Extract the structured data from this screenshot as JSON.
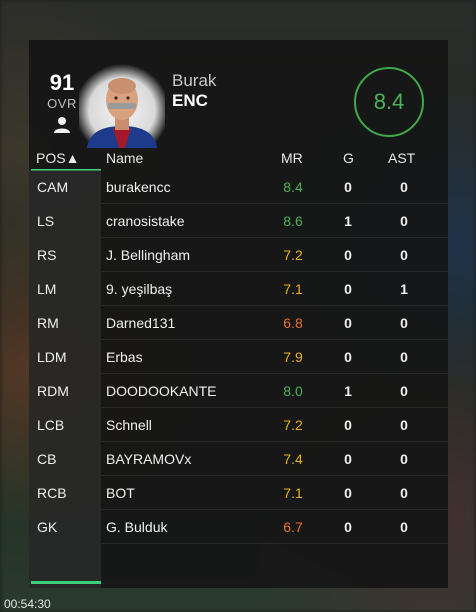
{
  "player": {
    "ovr": "91",
    "ovr_label": "OVR",
    "first_name": "Burak",
    "last_name": "ENC",
    "rating": "8.4",
    "rating_color": "#4cb25a"
  },
  "table": {
    "headers": {
      "pos": "POS▲",
      "name": "Name",
      "mr": "MR",
      "g": "G",
      "ast": "AST"
    },
    "rows": [
      {
        "pos": "CAM",
        "name": "burakencc",
        "mr": "8.4",
        "mr_color": "#4cb25a",
        "g": "0",
        "ast": "0"
      },
      {
        "pos": "LS",
        "name": "cranosistake",
        "mr": "8.6",
        "mr_color": "#4cb25a",
        "g": "1",
        "ast": "0"
      },
      {
        "pos": "RS",
        "name": "J. Bellingham",
        "mr": "7.2",
        "mr_color": "#e8b21e",
        "g": "0",
        "ast": "0"
      },
      {
        "pos": "LM",
        "name": "9. yeşilbaş",
        "mr": "7.1",
        "mr_color": "#e8b21e",
        "g": "0",
        "ast": "1"
      },
      {
        "pos": "RM",
        "name": "Darned131",
        "mr": "6.8",
        "mr_color": "#e8722a",
        "g": "0",
        "ast": "0"
      },
      {
        "pos": "LDM",
        "name": "Erbas",
        "mr": "7.9",
        "mr_color": "#e8b21e",
        "g": "0",
        "ast": "0"
      },
      {
        "pos": "RDM",
        "name": "DOODOOKANTE",
        "mr": "8.0",
        "mr_color": "#4cb25a",
        "g": "1",
        "ast": "0"
      },
      {
        "pos": "LCB",
        "name": "Schnell",
        "mr": "7.2",
        "mr_color": "#e8b21e",
        "g": "0",
        "ast": "0"
      },
      {
        "pos": "CB",
        "name": "BAYRAMOVx",
        "mr": "7.4",
        "mr_color": "#e8b21e",
        "g": "0",
        "ast": "0"
      },
      {
        "pos": "RCB",
        "name": "BOT",
        "mr": "7.1",
        "mr_color": "#e8b21e",
        "g": "0",
        "ast": "0"
      },
      {
        "pos": "GK",
        "name": "G. Bulduk",
        "mr": "6.7",
        "mr_color": "#e8722a",
        "g": "0",
        "ast": "0"
      }
    ]
  },
  "timestamp": "00:54:30",
  "colors": {
    "accent": "#3bd17a",
    "green": "#4cb25a",
    "yellow": "#e8b21e",
    "orange": "#e8722a"
  }
}
